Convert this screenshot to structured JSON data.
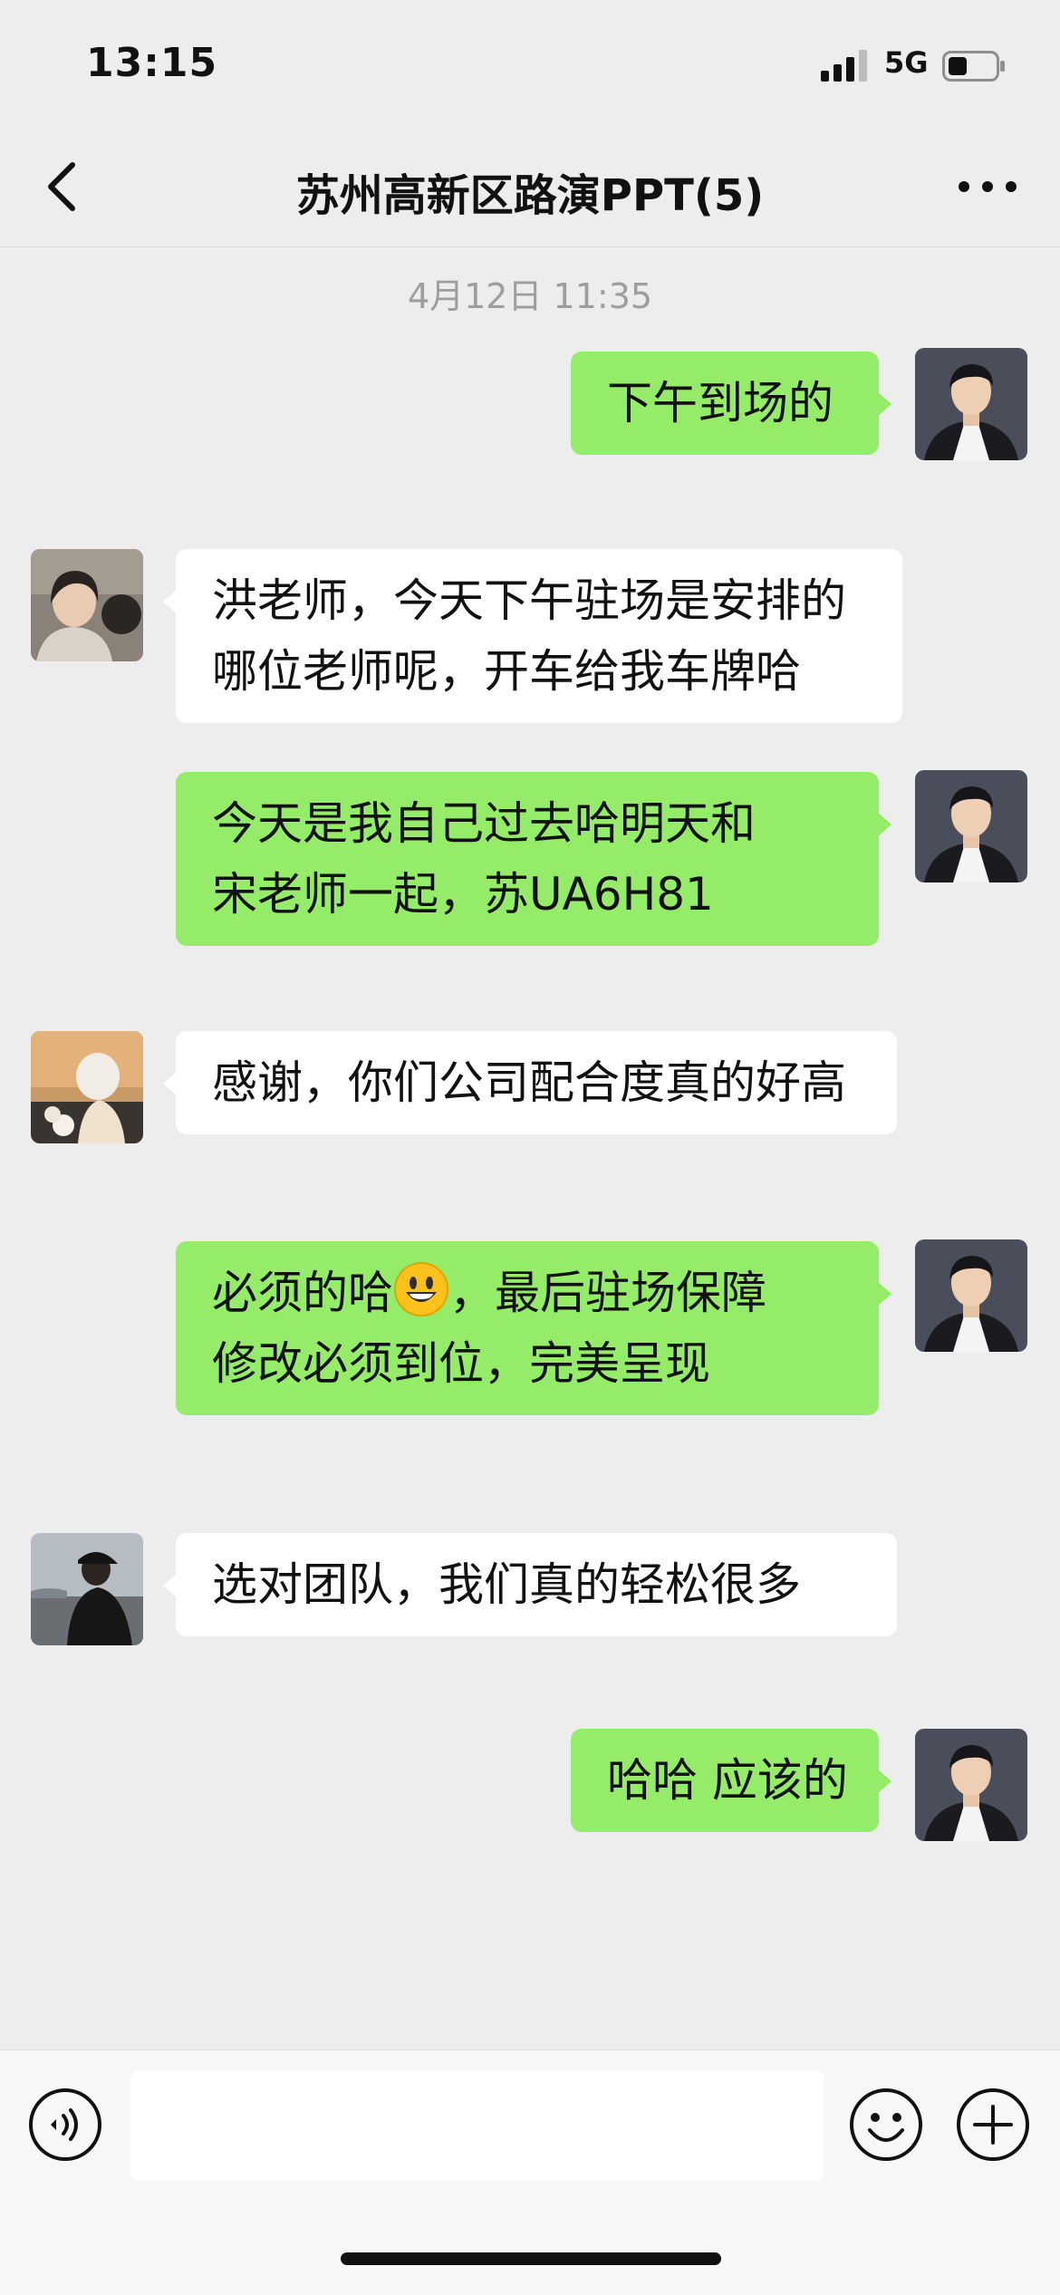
{
  "status_bar": {
    "time": "13:15",
    "network": "5G"
  },
  "header": {
    "title": "苏州高新区路演PPT(5)"
  },
  "chat": {
    "timestamp": "4月12日 11:35",
    "messages": [
      {
        "sender": "me",
        "avatar": "avatar-male-suit",
        "lines": [
          "下午到场的"
        ]
      },
      {
        "sender": "other",
        "avatar": "avatar-girl",
        "lines": [
          "洪老师，今天下午驻场是安排的",
          "哪位老师呢，开车给我车牌哈"
        ]
      },
      {
        "sender": "me",
        "avatar": "avatar-male-suit",
        "lines": [
          "今天是我自己过去哈明天和",
          "宋老师一起，苏UA6H81"
        ]
      },
      {
        "sender": "other",
        "avatar": "avatar-woman-hood",
        "lines": [
          "感谢，你们公司配合度真的好高"
        ]
      },
      {
        "sender": "me",
        "avatar": "avatar-male-suit",
        "lines": [
          "必须的哈",
          "，最后驻场保障",
          "修改必须到位，完美呈现"
        ],
        "emoji": "grinning-face"
      },
      {
        "sender": "other",
        "avatar": "avatar-man-cap",
        "lines": [
          "选对团队，我们真的轻松很多"
        ]
      },
      {
        "sender": "me",
        "avatar": "avatar-male-suit",
        "lines": [
          "哈哈 应该的"
        ]
      }
    ]
  },
  "input_bar": {
    "value": "",
    "icons": [
      "voice-icon",
      "emoji-icon",
      "plus-icon"
    ]
  },
  "colors": {
    "sent_bubble": "#95ec69",
    "received_bubble": "#ffffff",
    "background": "#ededed"
  }
}
